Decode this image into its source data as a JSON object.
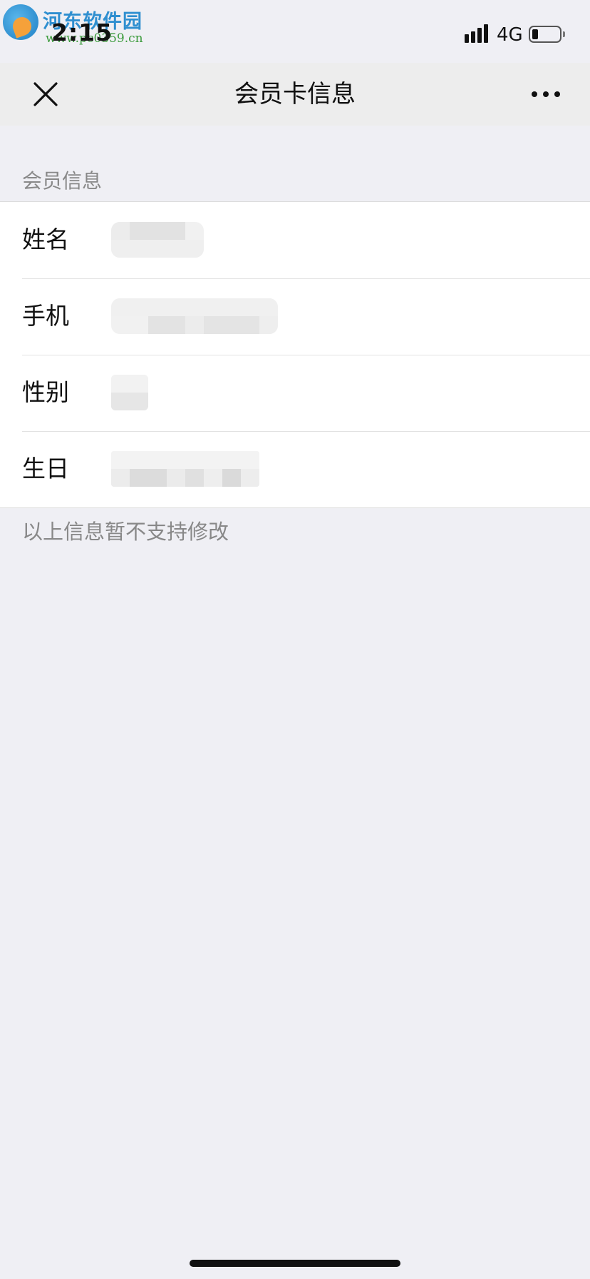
{
  "status_bar": {
    "time": "2:15",
    "network": "4G",
    "battery_level": 0.2
  },
  "watermark": {
    "name": "河东软件园",
    "url": "www.pc0359.cn"
  },
  "nav": {
    "title": "会员卡信息",
    "close_icon": "close-icon",
    "more_icon": "more-dots-icon"
  },
  "section": {
    "header": "会员信息"
  },
  "rows": [
    {
      "label": "姓名",
      "value_state": "blurred"
    },
    {
      "label": "手机",
      "value_state": "blurred"
    },
    {
      "label": "性别",
      "value_state": "blurred"
    },
    {
      "label": "生日",
      "value_state": "blurred"
    }
  ],
  "footer_note": "以上信息暂不支持修改",
  "colors": {
    "background": "#efeff4",
    "nav_background": "#ededed",
    "card_background": "#ffffff",
    "text_primary": "#111111",
    "text_secondary": "#888888"
  }
}
